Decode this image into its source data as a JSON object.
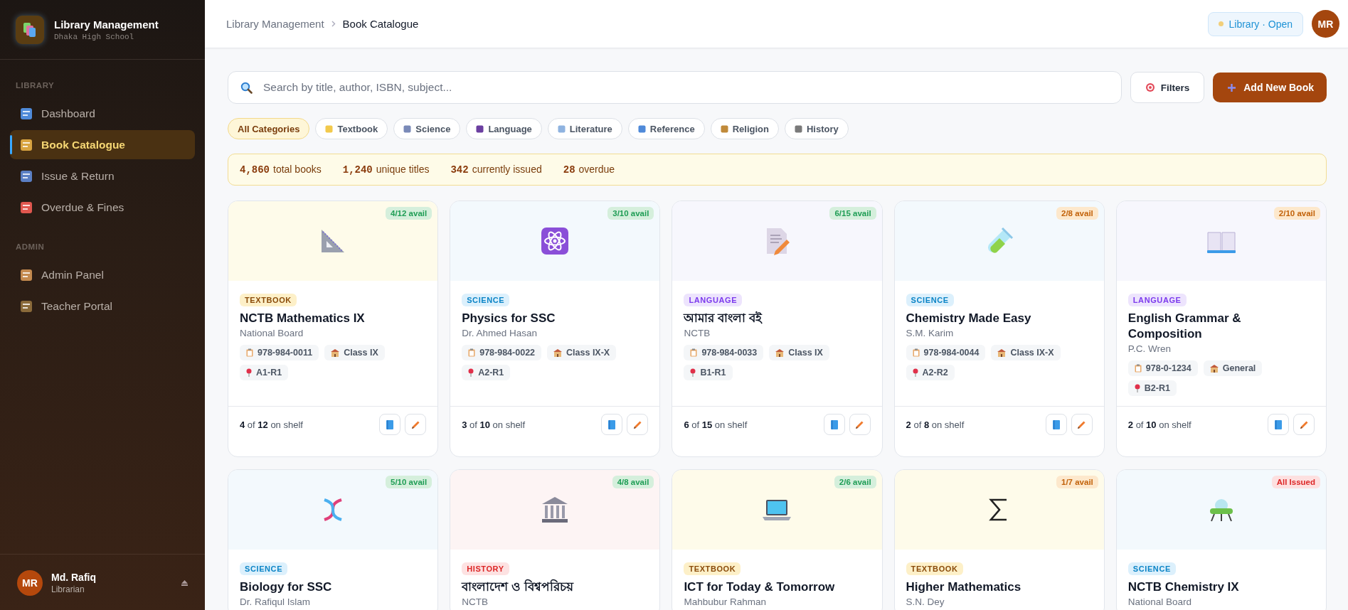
{
  "sidebar": {
    "brand": {
      "title": "Library Management",
      "subtitle": "Dhaka High School"
    },
    "sections": [
      {
        "heading": "LIBRARY",
        "items": [
          {
            "label": "Dashboard",
            "selected": false
          },
          {
            "label": "Book Catalogue",
            "selected": true
          },
          {
            "label": "Issue & Return",
            "selected": false
          },
          {
            "label": "Overdue & Fines",
            "selected": false
          }
        ]
      },
      {
        "heading": "ADMIN",
        "items": [
          {
            "label": "Admin Panel",
            "selected": false
          },
          {
            "label": "Teacher Portal",
            "selected": false
          }
        ]
      }
    ],
    "user": {
      "initials": "MR",
      "name": "Md. Rafiq",
      "role": "Librarian"
    }
  },
  "topbar": {
    "breadcrumb": [
      "Library Management",
      "Book Catalogue"
    ],
    "status": {
      "label": "Library · Open",
      "color": "#f2cf7a"
    },
    "avatar": "MR"
  },
  "search": {
    "placeholder": "Search by title, author, ISBN, subject..."
  },
  "buttons": {
    "filters": "Filters",
    "add": "Add New Book"
  },
  "categories": [
    {
      "label": "All Categories",
      "selected": true
    },
    {
      "label": "Textbook",
      "selected": false
    },
    {
      "label": "Science",
      "selected": false
    },
    {
      "label": "Language",
      "selected": false
    },
    {
      "label": "Literature",
      "selected": false
    },
    {
      "label": "Reference",
      "selected": false
    },
    {
      "label": "Religion",
      "selected": false
    },
    {
      "label": "History",
      "selected": false
    }
  ],
  "stats": [
    {
      "value": "4,860",
      "label": "total books"
    },
    {
      "value": "1,240",
      "label": "unique titles"
    },
    {
      "value": "342",
      "label": "currently issued"
    },
    {
      "value": "28",
      "label": "overdue"
    }
  ],
  "books": [
    {
      "badge": {
        "label": "4/12 avail",
        "kind": "ok"
      },
      "tag": {
        "label": "TEXTBOOK",
        "kind": "textbook"
      },
      "title": "NCTB Mathematics IX",
      "author": "National Board",
      "isbn": "978-984-0011",
      "class": "Class IX",
      "location": "A1-R1",
      "shelf": "**4** of **12** on shelf"
    },
    {
      "badge": {
        "label": "3/10 avail",
        "kind": "ok"
      },
      "tag": {
        "label": "SCIENCE",
        "kind": "science"
      },
      "title": "Physics for SSC",
      "author": "Dr. Ahmed Hasan",
      "isbn": "978-984-0022",
      "class": "Class IX-X",
      "location": "A2-R1",
      "shelf": "**3** of **10** on shelf"
    },
    {
      "badge": {
        "label": "6/15 avail",
        "kind": "ok"
      },
      "tag": {
        "label": "LANGUAGE",
        "kind": "language"
      },
      "title": "আমার বাংলা বই",
      "author": "NCTB",
      "isbn": "978-984-0033",
      "class": "Class IX",
      "location": "B1-R1",
      "shelf": "**6** of **15** on shelf"
    },
    {
      "badge": {
        "label": "2/8 avail",
        "kind": "low"
      },
      "tag": {
        "label": "SCIENCE",
        "kind": "science"
      },
      "title": "Chemistry Made Easy",
      "author": "S.M. Karim",
      "isbn": "978-984-0044",
      "class": "Class IX-X",
      "location": "A2-R2",
      "shelf": "**2** of **8** on shelf"
    },
    {
      "badge": {
        "label": "2/10 avail",
        "kind": "low"
      },
      "tag": {
        "label": "LANGUAGE",
        "kind": "language"
      },
      "title": "English Grammar & Composition",
      "author": "P.C. Wren",
      "isbn": "978-0-1234",
      "class": "General",
      "location": "B2-R1",
      "shelf": "**2** of **10** on shelf"
    },
    {
      "badge": {
        "label": "5/10 avail",
        "kind": "ok"
      },
      "tag": {
        "label": "SCIENCE",
        "kind": "science"
      },
      "title": "Biology for SSC",
      "author": "Dr. Rafiqul Islam"
    },
    {
      "badge": {
        "label": "4/8 avail",
        "kind": "ok"
      },
      "tag": {
        "label": "HISTORY",
        "kind": "history"
      },
      "title": "বাংলাদেশ ও বিশ্বপরিচয়",
      "author": "NCTB"
    },
    {
      "badge": {
        "label": "2/6 avail",
        "kind": "ok"
      },
      "tag": {
        "label": "TEXTBOOK",
        "kind": "textbook"
      },
      "title": "ICT for Today & Tomorrow",
      "author": "Mahbubur Rahman"
    },
    {
      "badge": {
        "label": "1/7 avail",
        "kind": "low"
      },
      "tag": {
        "label": "TEXTBOOK",
        "kind": "textbook"
      },
      "title": "Higher Mathematics",
      "author": "S.N. Dey"
    },
    {
      "badge": {
        "label": "All Issued",
        "kind": "none"
      },
      "tag": {
        "label": "SCIENCE",
        "kind": "science"
      },
      "title": "NCTB Chemistry IX",
      "author": "National Board"
    }
  ]
}
